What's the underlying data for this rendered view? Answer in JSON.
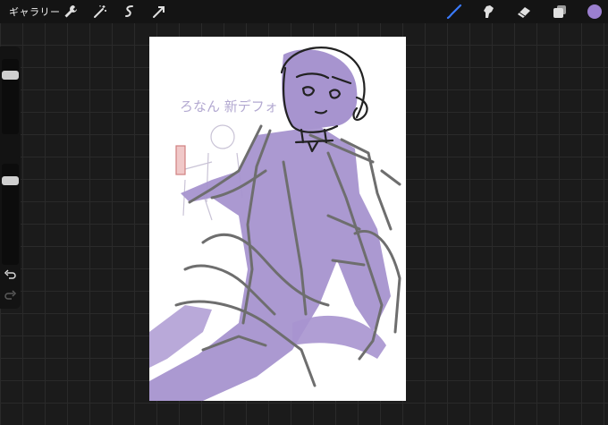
{
  "toolbar": {
    "gallery_label": "ギャラリー",
    "left_icons": [
      "wrench-icon",
      "magic-wand-icon",
      "selection-icon",
      "transform-arrow-icon"
    ],
    "right_icons": [
      "brush-icon",
      "smudge-icon",
      "eraser-icon",
      "layers-icon"
    ],
    "active_tool": "brush",
    "brush_accent": "#3a7bff",
    "current_color": "#9b7fcf"
  },
  "sidebar": {
    "brush_size": 0.65,
    "brush_opacity": 0.85,
    "icons": [
      "undo-icon",
      "redo-icon"
    ]
  },
  "canvas": {
    "sketch_text": "ろなん 新デフォ",
    "colors": {
      "fill": "#a794cf",
      "line_dark": "#222222",
      "line_gray": "#6e6e6e",
      "ghost": "#c9c3d6"
    }
  }
}
